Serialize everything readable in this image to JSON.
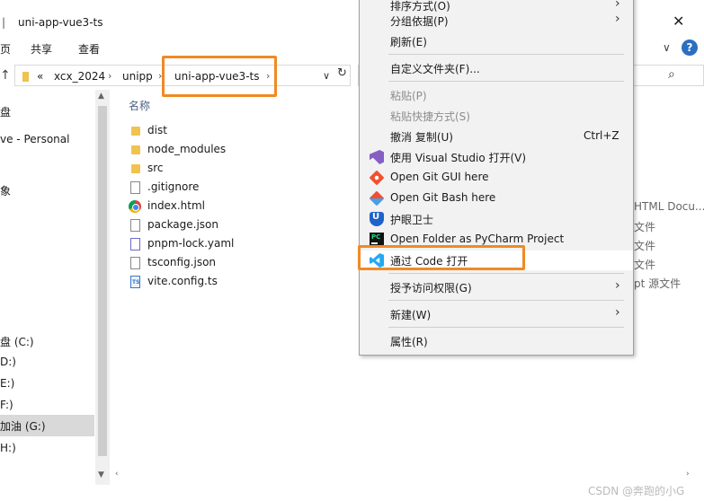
{
  "window": {
    "title": "uni-app-vue3-ts",
    "title_sep": "|",
    "close_glyph": "✕"
  },
  "ribbon": {
    "tab_view_partial": "页",
    "tab_share": "共享",
    "tab_view": "查看",
    "help": "?",
    "chevron": "∨"
  },
  "address": {
    "up": "↑",
    "overflow": "«",
    "crumbs": [
      "xcx_2024",
      "unipp",
      "uni-app-vue3-ts"
    ],
    "sep": "›",
    "dropdown": "∨",
    "refresh": "↻",
    "search_icon": "⌕"
  },
  "nav": {
    "items": [
      {
        "label": "盘"
      },
      {
        "label": "ve - Personal"
      },
      {
        "label": "象"
      },
      {
        "label": "盘 (C:)"
      },
      {
        "label": "D:)"
      },
      {
        "label": "E:)"
      },
      {
        "label": "F:)"
      },
      {
        "label": "加油 (G:)"
      },
      {
        "label": "H:)"
      }
    ],
    "scroll_up": "▲",
    "scroll_down": "▼"
  },
  "files": {
    "column_name": "名称",
    "rows": [
      {
        "name": "dist",
        "icon": "folder-icon"
      },
      {
        "name": "node_modules",
        "icon": "folder-icon"
      },
      {
        "name": "src",
        "icon": "folder-icon"
      },
      {
        "name": ".gitignore",
        "icon": "document-icon"
      },
      {
        "name": "index.html",
        "icon": "chrome-icon"
      },
      {
        "name": "package.json",
        "icon": "json-file-icon"
      },
      {
        "name": "pnpm-lock.yaml",
        "icon": "yaml-file-icon"
      },
      {
        "name": "tsconfig.json",
        "icon": "json-file-icon"
      },
      {
        "name": "vite.config.ts",
        "icon": "typescript-file-icon"
      }
    ],
    "type_partials": [
      "HTML Docu...",
      "文件",
      "文件",
      "文件",
      "pt 源文件"
    ],
    "scroll_left": "‹",
    "scroll_right": "›"
  },
  "context_menu": {
    "items": {
      "sort_by": "排序方式(O)",
      "group_by": "分组依据(P)",
      "refresh": "刷新(E)",
      "customize": "自定义文件夹(F)...",
      "paste": "粘贴(P)",
      "paste_shortcut": "粘贴快捷方式(S)",
      "undo_copy": "撤消 复制(U)",
      "undo_shortcut": "Ctrl+Z",
      "open_vs": "使用 Visual Studio 打开(V)",
      "git_gui": "Open Git GUI here",
      "git_bash": "Open Git Bash here",
      "eye_guard": "护眼卫士",
      "pycharm": "Open Folder as PyCharm Project",
      "open_code": "通过 Code 打开",
      "grant_access": "授予访问权限(G)",
      "new": "新建(W)",
      "properties": "属性(R)"
    },
    "submenu_arrow": "›"
  },
  "watermark": "CSDN @奔跑的小G",
  "colors": {
    "highlight": "#f08a24",
    "menu_bg": "#f2f2f2",
    "header_text": "#4d6082"
  }
}
